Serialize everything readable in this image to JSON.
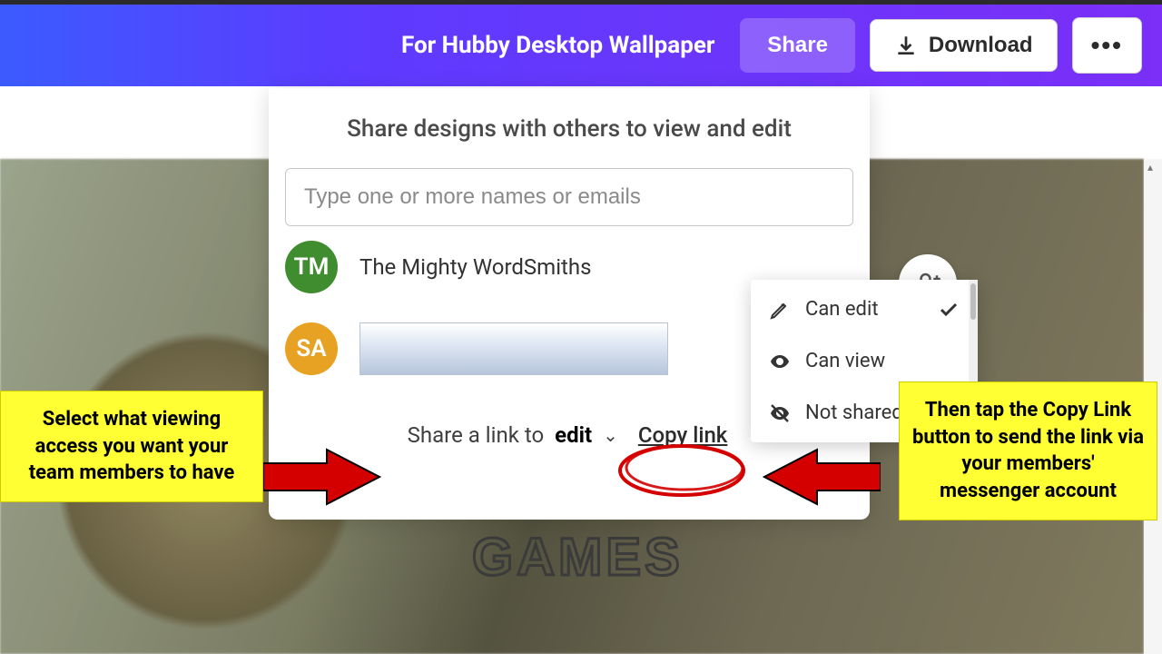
{
  "header": {
    "title": "For Hubby Desktop Wallpaper",
    "share_label": "Share",
    "download_label": "Download",
    "more_label": "•••"
  },
  "share_panel": {
    "title": "Share designs with others to view and edit",
    "input_placeholder": "Type one or more names or emails",
    "members": [
      {
        "initials": "TM",
        "name": "The Mighty WordSmiths"
      },
      {
        "initials": "SA",
        "name": ""
      }
    ],
    "link_row": {
      "prefix": "Share a link to",
      "mode": "edit",
      "copy_label": "Copy link"
    }
  },
  "perm_menu": {
    "items": [
      {
        "label": "Can edit",
        "selected": true
      },
      {
        "label": "Can view",
        "selected": false
      },
      {
        "label": "Not shared",
        "selected": false
      }
    ]
  },
  "canvas": {
    "stamp_text": "GAMES"
  },
  "annotations": {
    "left": "Select what viewing access you want your team members to have",
    "right": "Then tap the Copy Link button to send the link via your members' messenger account"
  }
}
